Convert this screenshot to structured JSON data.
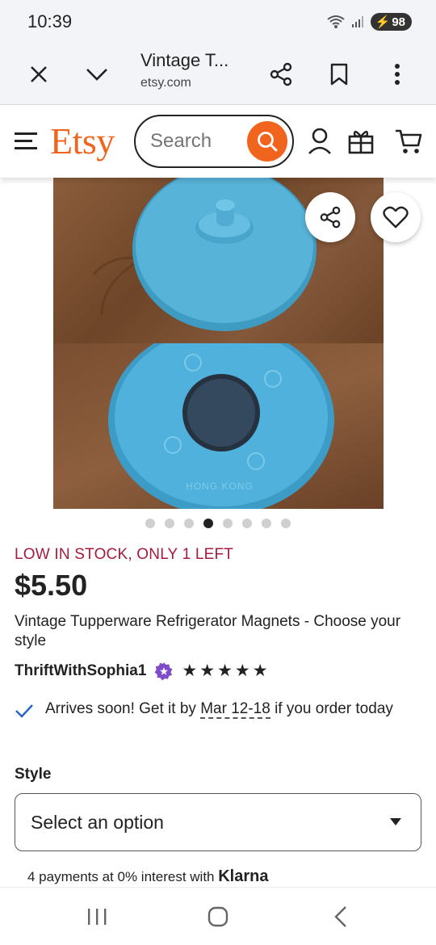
{
  "status_bar": {
    "time": "10:39",
    "battery": "98"
  },
  "browser": {
    "tab_title": "Vintage T...",
    "url": "etsy.com"
  },
  "etsy_header": {
    "logo": "Etsy",
    "search_placeholder": "Search",
    "brand_color": "#f1641e"
  },
  "carousel": {
    "total": 8,
    "active_index": 3,
    "image_text": "HONG KONG"
  },
  "product": {
    "stock_notice": "LOW IN STOCK, ONLY 1 LEFT",
    "price": "$5.50",
    "title": "Vintage Tupperware Refrigerator Magnets - Choose your style",
    "shop_name": "ThriftWithSophia1",
    "rating": 5,
    "arrival_prefix": "Arrives soon! Get it by ",
    "arrival_dates": "Mar 12-18",
    "arrival_suffix": " if you order today"
  },
  "options": {
    "style_label": "Style",
    "select_value": "Select an option"
  },
  "payment": {
    "klarna_text": "4 payments at 0% interest with ",
    "klarna_brand": "Klarna"
  }
}
